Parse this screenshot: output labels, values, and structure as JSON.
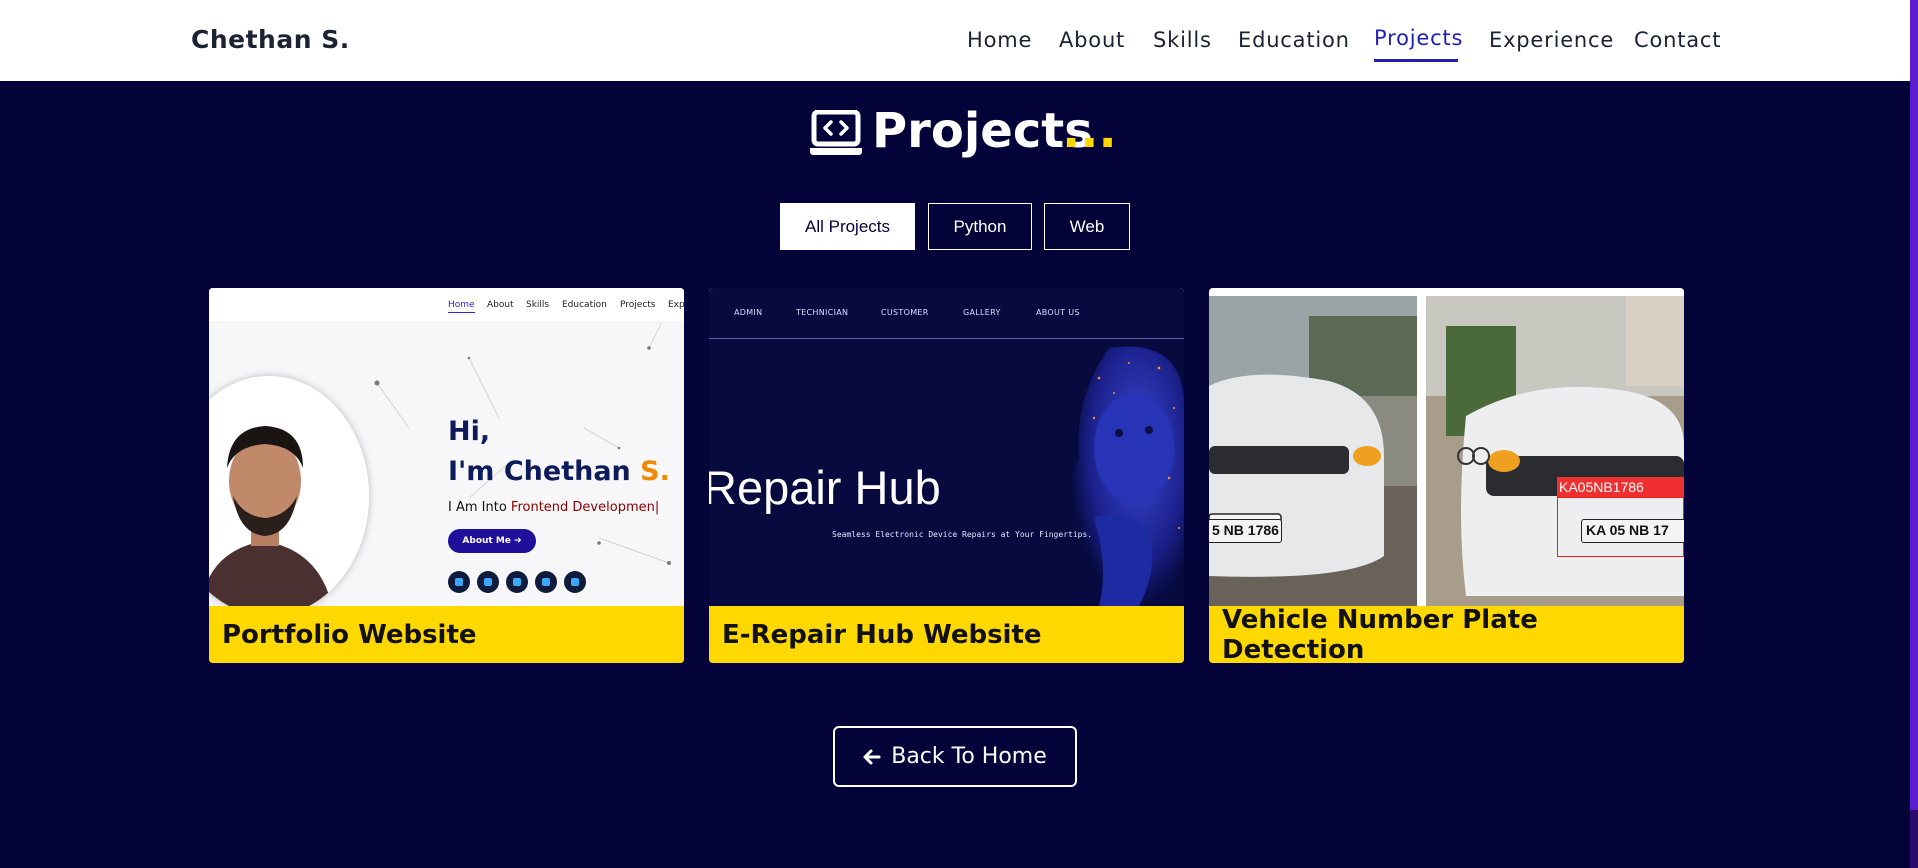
{
  "navbar": {
    "brand": "Chethan S.",
    "items": [
      {
        "label": "Home"
      },
      {
        "label": "About"
      },
      {
        "label": "Skills"
      },
      {
        "label": "Education"
      },
      {
        "label": "Projects",
        "active": true
      },
      {
        "label": "Experience"
      },
      {
        "label": "Contact"
      }
    ]
  },
  "heading": {
    "icon": "laptop-code-icon",
    "title": "Projects",
    "dots": "..."
  },
  "filters": [
    {
      "label": "All Projects",
      "active": true
    },
    {
      "label": "Python"
    },
    {
      "label": "Web"
    }
  ],
  "projects": [
    {
      "title": "Portfolio Website",
      "preview": {
        "nav": [
          "Home",
          "About",
          "Skills",
          "Education",
          "Projects",
          "Exp"
        ],
        "hi": "Hi,",
        "name_prefix": "I'm Chethan ",
        "name_suffix": "S.",
        "into_prefix": "I Am Into ",
        "into_role": "Frontend Developmen|",
        "button": "About Me",
        "social_icons": [
          "linkedin-icon",
          "github-icon",
          "twitter-icon",
          "instagram-icon",
          "facebook-icon"
        ]
      }
    },
    {
      "title": "E-Repair Hub Website",
      "preview": {
        "nav": [
          "ADMIN",
          "TECHNICIAN",
          "CUSTOMER",
          "GALLERY",
          "ABOUT US"
        ],
        "title": "Repair Hub",
        "subtitle": "Seamless Electronic Device Repairs at Your Fingertips."
      }
    },
    {
      "title": "Vehicle Number Plate Detection",
      "preview": {
        "left_plate": "5 NB 1786",
        "detected_label": "KA05NB1786",
        "right_plate": "KA 05 NB 17"
      }
    }
  ],
  "back_button": {
    "label": "Back To Home",
    "icon": "arrow-left-icon"
  },
  "colors": {
    "background": "#03033a",
    "accent": "#ffd700",
    "nav_active": "#1f1fb5",
    "caption_bg": "#ffd800"
  }
}
